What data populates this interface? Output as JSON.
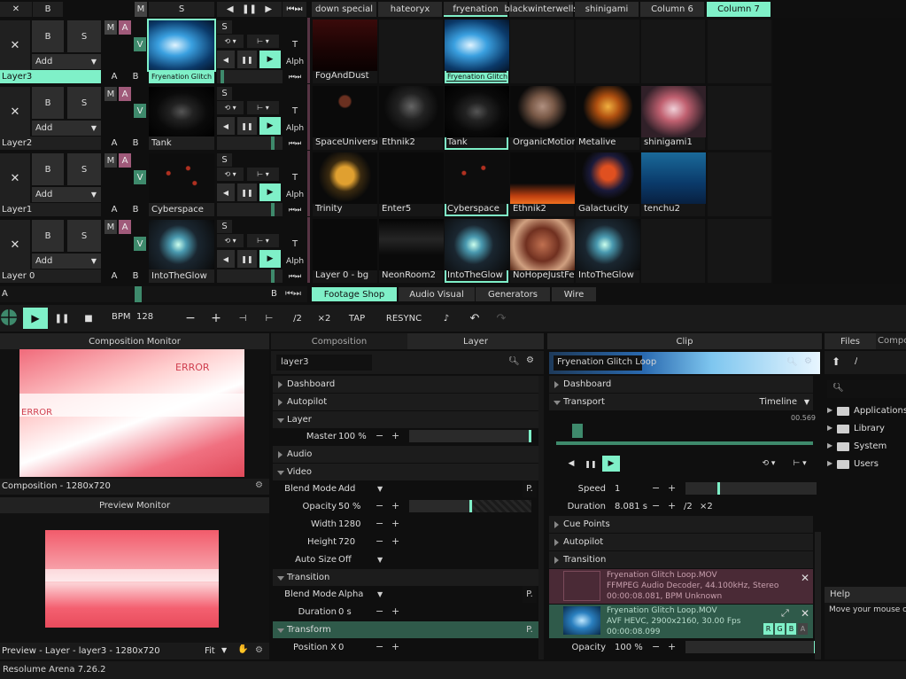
{
  "layers_header": {
    "close_label": "✕",
    "b_label": "B",
    "m_label": "M",
    "s_label": "S"
  },
  "deck_tabs": [
    "down special",
    "hateoryx",
    "fryenation",
    "blackwinterwells",
    "shinigami",
    "Column 6",
    "Column 7"
  ],
  "layers": [
    {
      "name": "Layer3",
      "clip": "Fryenation Glitch L...",
      "add": "Add",
      "selected": true
    },
    {
      "name": "Layer2",
      "clip": "Tank",
      "add": "Add",
      "selected": false
    },
    {
      "name": "Layer1",
      "clip": "Cyberspace",
      "add": "Add",
      "selected": false
    },
    {
      "name": "Layer 0",
      "clip": "IntoTheGlow",
      "add": "Add",
      "selected": false
    }
  ],
  "layer_controls": {
    "b": "B",
    "s": "S",
    "m": "M",
    "a": "A",
    "v": "V",
    "t": "T",
    "alph": "Alph",
    "a_bottom": "A",
    "b_bottom": "B"
  },
  "clip_grid": [
    [
      "FogAndDust",
      "",
      "Fryenation Glitch L...",
      "",
      "",
      "",
      ""
    ],
    [
      "SpaceUniverse",
      "Ethnik2",
      "Tank",
      "OrganicMotions",
      "Metalive",
      "shinigami1",
      ""
    ],
    [
      "Trinity",
      "Enter5",
      "Cyberspace",
      "Ethnik2",
      "Galactucity",
      "tenchu2",
      ""
    ],
    [
      "Layer 0 - bg",
      "NeonRoom2",
      "IntoTheGlow",
      "NoHopeJustFear",
      "IntoTheGlow",
      "",
      ""
    ]
  ],
  "bottom_tabs": [
    "Footage Shop",
    "Audio Visual",
    "Generators",
    "Wire"
  ],
  "crossfader": {
    "a": "A",
    "b": "B"
  },
  "transport": {
    "bpm_label": "BPM",
    "bpm": "128",
    "minus": "−",
    "plus": "+",
    "half": "/2",
    "double": "×2",
    "tap": "TAP",
    "resync": "RESYNC"
  },
  "comp_monitor": {
    "title": "Composition Monitor",
    "footer": "Composition - 1280x720",
    "overlay_text_1": "ERROR",
    "overlay_text_2": "ERROR"
  },
  "preview_monitor": {
    "title": "Preview Monitor",
    "footer": "Preview - Layer - layer3 - 1280x720",
    "fit": "Fit"
  },
  "layer_panel": {
    "tabs": [
      "Composition",
      "Layer"
    ],
    "name": "layer3",
    "sections": {
      "dashboard": "Dashboard",
      "autopilot": "Autopilot",
      "layer": "Layer",
      "audio": "Audio",
      "video": "Video",
      "transition": "Transition",
      "transform": "Transform"
    },
    "master_label": "Master",
    "master_value": "100 %",
    "master_level": 1.0,
    "blend_label": "Blend Mode",
    "blend_value": "Add",
    "opacity_label": "Opacity",
    "opacity_value": "50 %",
    "opacity_level": 0.5,
    "width_label": "Width",
    "width_value": "1280",
    "height_label": "Height",
    "height_value": "720",
    "autosize_label": "Auto Size",
    "autosize_value": "Off",
    "t_blend_label": "Blend Mode",
    "t_blend_value": "Alpha",
    "duration_label": "Duration",
    "duration_value": "0 s",
    "posx_label": "Position X",
    "posx_value": "0",
    "p_label": "P."
  },
  "clip_panel": {
    "title": "Clip",
    "clip_name": "Fryenation Glitch Loop",
    "sections": {
      "dashboard": "Dashboard",
      "transport": "Transport",
      "cue_points": "Cue Points",
      "autopilot": "Autopilot",
      "transition": "Transition"
    },
    "timeline": "Timeline",
    "time_value": "00.569",
    "speed_label": "Speed",
    "speed_value": "1",
    "duration_label": "Duration",
    "duration_value": "8.081 s",
    "half": "/2",
    "double": "×2",
    "audio_file": {
      "name": "Fryenation Glitch Loop.MOV",
      "line1": "FFMPEG Audio Decoder, 44.100kHz, Stereo",
      "line2": "00:00:08.081, BPM Unknown"
    },
    "video_file": {
      "name": "Fryenation Glitch Loop.MOV",
      "line1": "AVF HEVC, 2900x2160, 30.00 Fps",
      "line2": "00:00:08.099"
    },
    "rgba": [
      "R",
      "G",
      "B",
      "A"
    ],
    "opacity_label": "Opacity",
    "opacity_value": "100 %",
    "opacity_level": 1.0
  },
  "files_panel": {
    "tabs": [
      "Files",
      "Compo"
    ],
    "path": "/",
    "items": [
      "Applications",
      "Library",
      "System",
      "Users"
    ]
  },
  "help_panel": {
    "title": "Help",
    "text": "Move your mouse over t"
  },
  "status_bar": {
    "version": "Resolume Arena 7.26.2"
  },
  "colors": {
    "accent": "#7ff0c8",
    "pink": "#a05a7a",
    "green": "#3e8a6c",
    "panel": "#1c1c1c"
  }
}
